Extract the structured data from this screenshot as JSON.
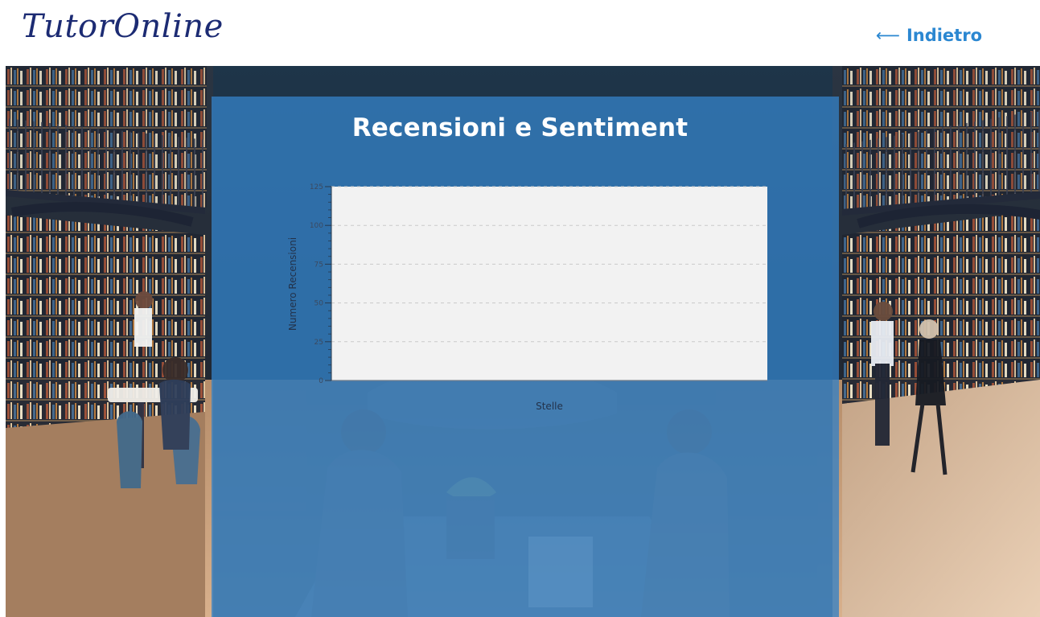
{
  "header": {
    "brand": "TutorOnline",
    "back_arrow": "⟵",
    "back_label": "Indietro"
  },
  "panel": {
    "title": "Recensioni e Sentiment"
  },
  "chart_data": {
    "type": "bar",
    "title": "",
    "xlabel": "Stelle",
    "ylabel": "Numero Recensioni",
    "ylim": [
      0,
      125
    ],
    "y_ticks": [
      0,
      25,
      50,
      75,
      100,
      125
    ],
    "categories": [],
    "values": [],
    "grid": "horizontal dashed"
  },
  "colors": {
    "brand": "#1c2b73",
    "accent": "#2b87d1",
    "panel": "#3580c4",
    "chart_bg": "#f2f2f2"
  }
}
